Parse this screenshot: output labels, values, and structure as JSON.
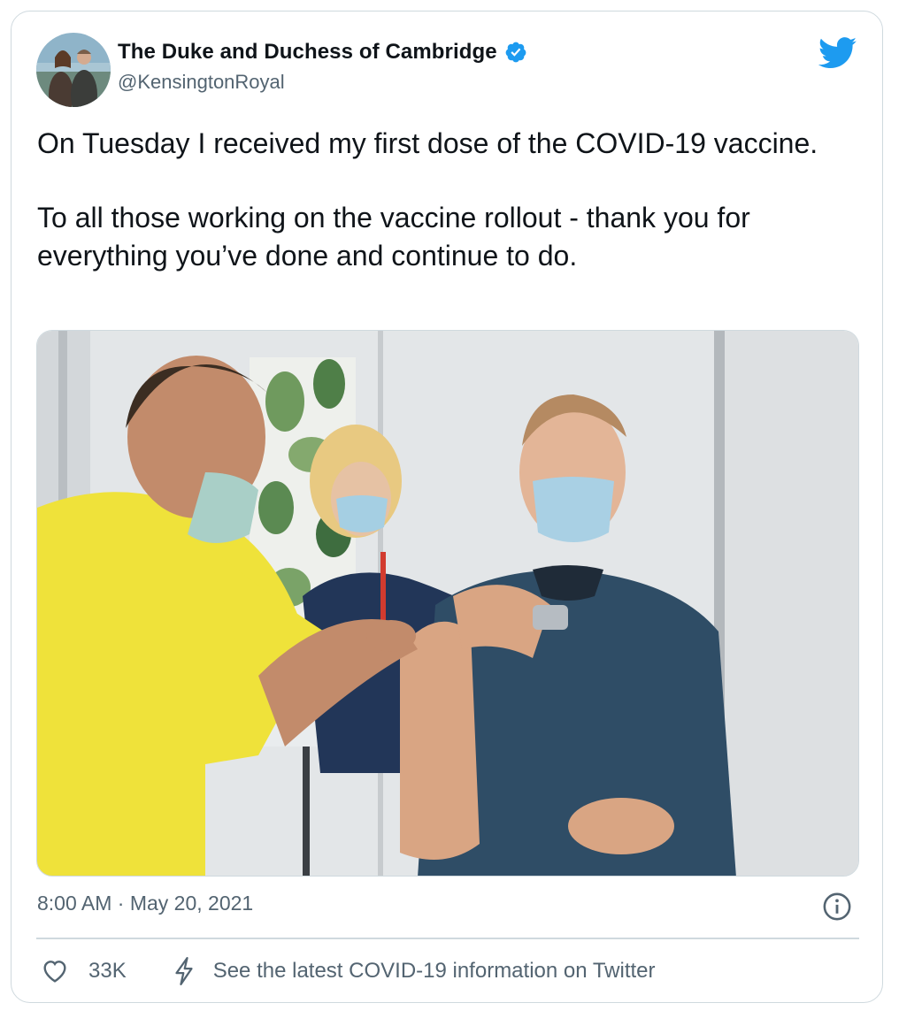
{
  "tweet": {
    "display_name": "The Duke and Duchess of Cambridge",
    "handle": "@KensingtonRoyal",
    "verified": true,
    "text_paragraphs": [
      "On Tuesday I received my first dose of the COVID-19 vaccine.",
      "To all those working on the vaccine rollout - thank you for everything you’ve done and continue to do."
    ],
    "timestamp": "8:00 AM · May 20, 2021",
    "like_count": "33K",
    "covid_info_label": "See the latest COVID-19 information on Twitter"
  },
  "icons": {
    "brand": "twitter-bird-icon",
    "verified": "verified-badge-icon",
    "info": "info-icon",
    "like": "heart-icon",
    "covid": "lightning-bolt-icon"
  },
  "colors": {
    "twitter_blue": "#1d9bf0",
    "text_primary": "#0f1419",
    "text_secondary": "#536471",
    "border": "#cfd9de"
  }
}
